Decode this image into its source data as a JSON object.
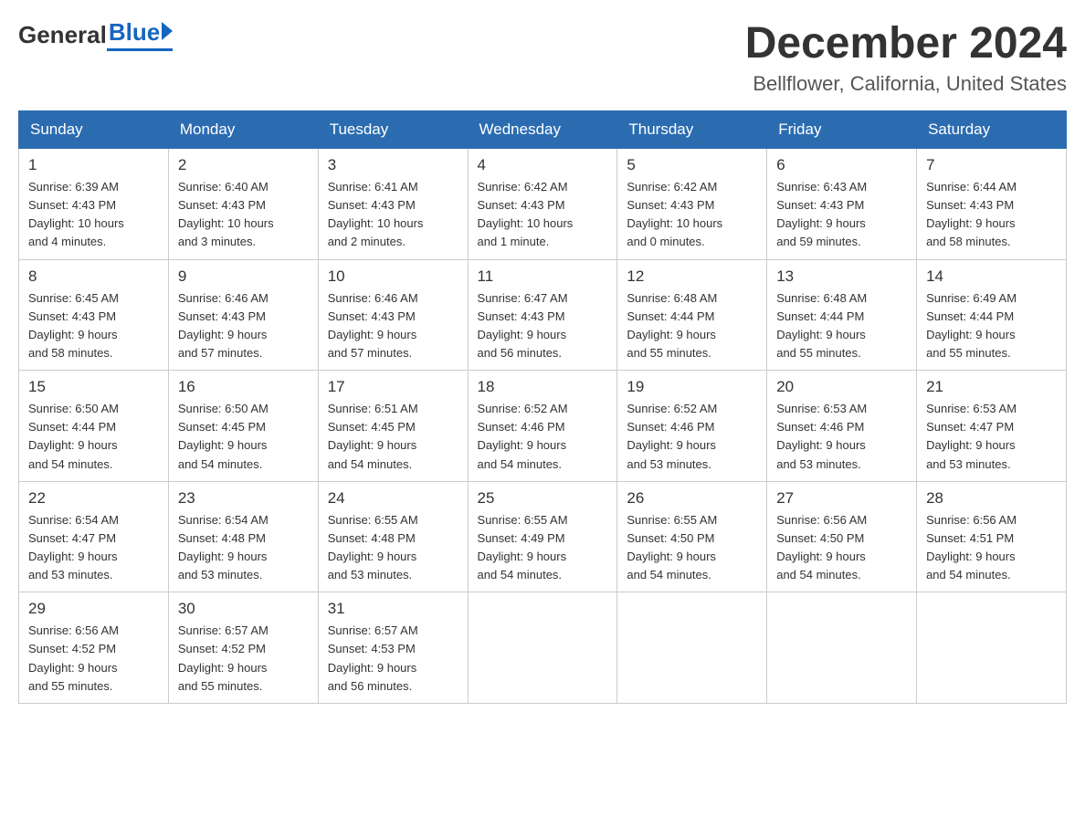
{
  "header": {
    "logo_general": "General",
    "logo_blue": "Blue",
    "title": "December 2024",
    "subtitle": "Bellflower, California, United States"
  },
  "columns": [
    "Sunday",
    "Monday",
    "Tuesday",
    "Wednesday",
    "Thursday",
    "Friday",
    "Saturday"
  ],
  "weeks": [
    [
      {
        "day": "1",
        "info": "Sunrise: 6:39 AM\nSunset: 4:43 PM\nDaylight: 10 hours\nand 4 minutes."
      },
      {
        "day": "2",
        "info": "Sunrise: 6:40 AM\nSunset: 4:43 PM\nDaylight: 10 hours\nand 3 minutes."
      },
      {
        "day": "3",
        "info": "Sunrise: 6:41 AM\nSunset: 4:43 PM\nDaylight: 10 hours\nand 2 minutes."
      },
      {
        "day": "4",
        "info": "Sunrise: 6:42 AM\nSunset: 4:43 PM\nDaylight: 10 hours\nand 1 minute."
      },
      {
        "day": "5",
        "info": "Sunrise: 6:42 AM\nSunset: 4:43 PM\nDaylight: 10 hours\nand 0 minutes."
      },
      {
        "day": "6",
        "info": "Sunrise: 6:43 AM\nSunset: 4:43 PM\nDaylight: 9 hours\nand 59 minutes."
      },
      {
        "day": "7",
        "info": "Sunrise: 6:44 AM\nSunset: 4:43 PM\nDaylight: 9 hours\nand 58 minutes."
      }
    ],
    [
      {
        "day": "8",
        "info": "Sunrise: 6:45 AM\nSunset: 4:43 PM\nDaylight: 9 hours\nand 58 minutes."
      },
      {
        "day": "9",
        "info": "Sunrise: 6:46 AM\nSunset: 4:43 PM\nDaylight: 9 hours\nand 57 minutes."
      },
      {
        "day": "10",
        "info": "Sunrise: 6:46 AM\nSunset: 4:43 PM\nDaylight: 9 hours\nand 57 minutes."
      },
      {
        "day": "11",
        "info": "Sunrise: 6:47 AM\nSunset: 4:43 PM\nDaylight: 9 hours\nand 56 minutes."
      },
      {
        "day": "12",
        "info": "Sunrise: 6:48 AM\nSunset: 4:44 PM\nDaylight: 9 hours\nand 55 minutes."
      },
      {
        "day": "13",
        "info": "Sunrise: 6:48 AM\nSunset: 4:44 PM\nDaylight: 9 hours\nand 55 minutes."
      },
      {
        "day": "14",
        "info": "Sunrise: 6:49 AM\nSunset: 4:44 PM\nDaylight: 9 hours\nand 55 minutes."
      }
    ],
    [
      {
        "day": "15",
        "info": "Sunrise: 6:50 AM\nSunset: 4:44 PM\nDaylight: 9 hours\nand 54 minutes."
      },
      {
        "day": "16",
        "info": "Sunrise: 6:50 AM\nSunset: 4:45 PM\nDaylight: 9 hours\nand 54 minutes."
      },
      {
        "day": "17",
        "info": "Sunrise: 6:51 AM\nSunset: 4:45 PM\nDaylight: 9 hours\nand 54 minutes."
      },
      {
        "day": "18",
        "info": "Sunrise: 6:52 AM\nSunset: 4:46 PM\nDaylight: 9 hours\nand 54 minutes."
      },
      {
        "day": "19",
        "info": "Sunrise: 6:52 AM\nSunset: 4:46 PM\nDaylight: 9 hours\nand 53 minutes."
      },
      {
        "day": "20",
        "info": "Sunrise: 6:53 AM\nSunset: 4:46 PM\nDaylight: 9 hours\nand 53 minutes."
      },
      {
        "day": "21",
        "info": "Sunrise: 6:53 AM\nSunset: 4:47 PM\nDaylight: 9 hours\nand 53 minutes."
      }
    ],
    [
      {
        "day": "22",
        "info": "Sunrise: 6:54 AM\nSunset: 4:47 PM\nDaylight: 9 hours\nand 53 minutes."
      },
      {
        "day": "23",
        "info": "Sunrise: 6:54 AM\nSunset: 4:48 PM\nDaylight: 9 hours\nand 53 minutes."
      },
      {
        "day": "24",
        "info": "Sunrise: 6:55 AM\nSunset: 4:48 PM\nDaylight: 9 hours\nand 53 minutes."
      },
      {
        "day": "25",
        "info": "Sunrise: 6:55 AM\nSunset: 4:49 PM\nDaylight: 9 hours\nand 54 minutes."
      },
      {
        "day": "26",
        "info": "Sunrise: 6:55 AM\nSunset: 4:50 PM\nDaylight: 9 hours\nand 54 minutes."
      },
      {
        "day": "27",
        "info": "Sunrise: 6:56 AM\nSunset: 4:50 PM\nDaylight: 9 hours\nand 54 minutes."
      },
      {
        "day": "28",
        "info": "Sunrise: 6:56 AM\nSunset: 4:51 PM\nDaylight: 9 hours\nand 54 minutes."
      }
    ],
    [
      {
        "day": "29",
        "info": "Sunrise: 6:56 AM\nSunset: 4:52 PM\nDaylight: 9 hours\nand 55 minutes."
      },
      {
        "day": "30",
        "info": "Sunrise: 6:57 AM\nSunset: 4:52 PM\nDaylight: 9 hours\nand 55 minutes."
      },
      {
        "day": "31",
        "info": "Sunrise: 6:57 AM\nSunset: 4:53 PM\nDaylight: 9 hours\nand 56 minutes."
      },
      {
        "day": "",
        "info": ""
      },
      {
        "day": "",
        "info": ""
      },
      {
        "day": "",
        "info": ""
      },
      {
        "day": "",
        "info": ""
      }
    ]
  ]
}
